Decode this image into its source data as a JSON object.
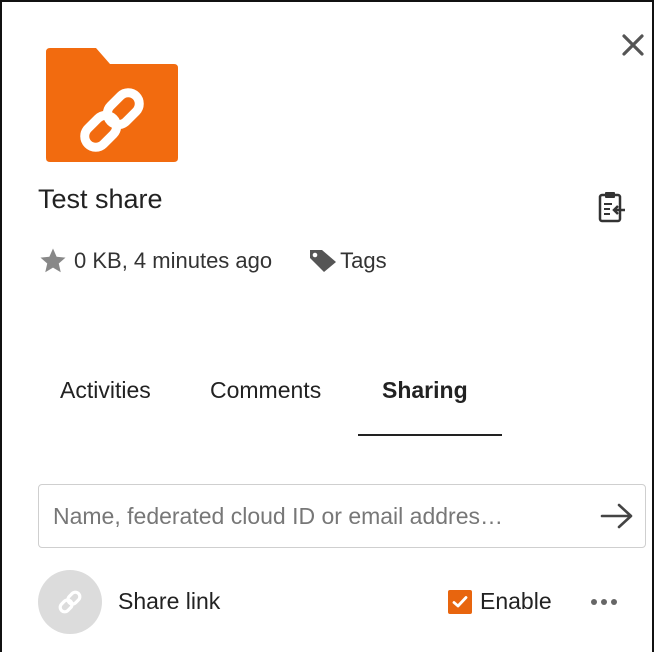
{
  "file": {
    "title": "Test share",
    "size": "0 KB",
    "time": "4 minutes ago",
    "meta_text": "0 KB, 4 minutes ago",
    "tags_label": "Tags"
  },
  "tabs": [
    {
      "label": "Activities",
      "active": false
    },
    {
      "label": "Comments",
      "active": false
    },
    {
      "label": "Sharing",
      "active": true
    }
  ],
  "share": {
    "input_value": "",
    "placeholder": "Name, federated cloud ID or email addres…",
    "link_label": "Share link",
    "enable_label": "Enable",
    "enable_checked": true
  },
  "colors": {
    "accent": "#e8650e",
    "folder": "#f26b0f"
  },
  "icons": {
    "close": "close-icon",
    "folder": "link-folder-icon",
    "clipboard": "clipboard-icon",
    "star": "star-icon",
    "tag": "tag-icon",
    "arrow": "arrow-right-icon",
    "link": "link-icon",
    "more": "more-icon"
  }
}
